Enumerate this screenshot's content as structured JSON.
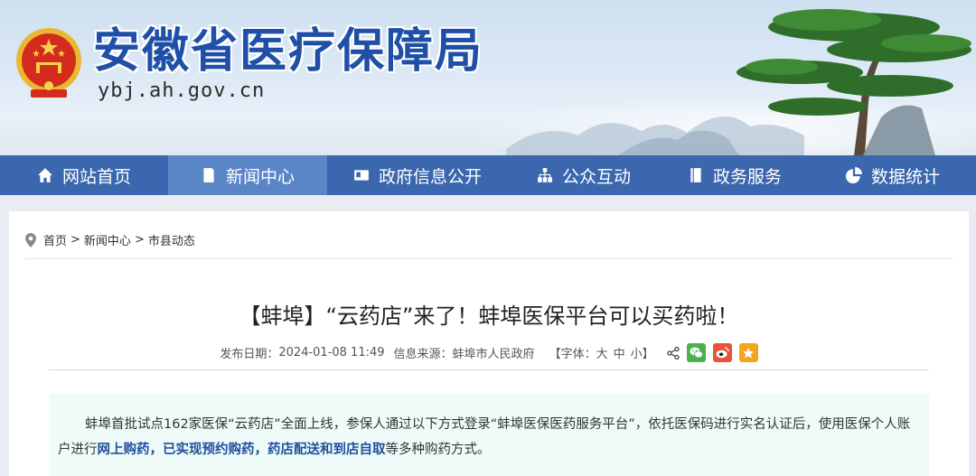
{
  "header": {
    "site_title": "安徽省医疗保障局",
    "site_domain": "ybj.ah.gov.cn"
  },
  "nav": {
    "items": [
      {
        "label": "网站首页",
        "icon": "home-icon"
      },
      {
        "label": "新闻中心",
        "icon": "document-icon",
        "active": true
      },
      {
        "label": "政府信息公开",
        "icon": "id-card-icon"
      },
      {
        "label": "公众互动",
        "icon": "org-chart-icon"
      },
      {
        "label": "政务服务",
        "icon": "book-icon"
      },
      {
        "label": "数据统计",
        "icon": "pie-chart-icon"
      }
    ]
  },
  "breadcrumb": {
    "home": "首页",
    "sep": ">",
    "level1": "新闻中心",
    "level2": "市县动态"
  },
  "article": {
    "title": "【蚌埠】“云药店”来了！蚌埠医保平台可以买药啦！",
    "publish_label": "发布日期：",
    "publish_date": "2024-01-08 11:49",
    "source_label": "信息来源：",
    "source": "蚌埠市人民政府",
    "font_label": "【字体：",
    "font_large": "大",
    "font_medium": "中",
    "font_small": "小",
    "font_close": "】",
    "summary_part1": "蚌埠首批试点162家医保“云药店”全面上线，参保人通过以下方式登录“蚌埠医保医药服务平台”，依托医保码进行实名认证后，使用医保个人账户进行",
    "summary_bold": "网上购药，已实现预约购药，药店配送和到店自取",
    "summary_part2": "等多种购药方式。"
  },
  "colors": {
    "nav_bg": "#3a67ad",
    "nav_active": "#5a86c8",
    "title_blue": "#1f4fa7",
    "wechat": "#4bb14a",
    "weibo": "#e8533a",
    "favorite": "#f2a51d",
    "summary_bg": "#eefbf8"
  }
}
